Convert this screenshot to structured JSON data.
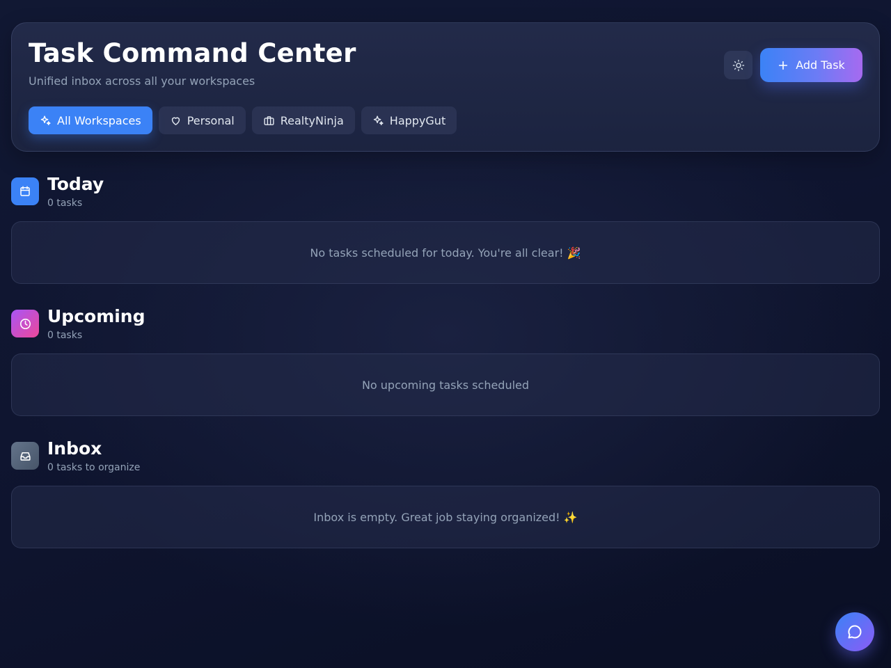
{
  "header": {
    "title": "Task Command Center",
    "subtitle": "Unified inbox across all your workspaces",
    "theme_toggle_icon": "sun-icon",
    "add_task_label": "Add Task",
    "add_task_icon": "plus-icon"
  },
  "workspaces": [
    {
      "label": "All Workspaces",
      "icon": "sparkles-icon",
      "active": true
    },
    {
      "label": "Personal",
      "icon": "heart-icon",
      "active": false
    },
    {
      "label": "RealtyNinja",
      "icon": "briefcase-icon",
      "active": false
    },
    {
      "label": "HappyGut",
      "icon": "sparkles-icon",
      "active": false
    }
  ],
  "sections": {
    "today": {
      "title": "Today",
      "count": "0 tasks",
      "icon": "calendar-icon",
      "empty_message": "No tasks scheduled for today. You're all clear! 🎉"
    },
    "upcoming": {
      "title": "Upcoming",
      "count": "0 tasks",
      "icon": "clock-icon",
      "empty_message": "No upcoming tasks scheduled"
    },
    "inbox": {
      "title": "Inbox",
      "count": "0 tasks to organize",
      "icon": "inbox-icon",
      "empty_message": "Inbox is empty. Great job staying organized! ✨"
    }
  },
  "chat_button_icon": "chat-bubble-icon",
  "colors": {
    "accent_blue": "#3b82f6",
    "accent_purple": "#a855f7",
    "today_icon_bg": "#3b82f6",
    "upcoming_icon_bg": "#c04ad8",
    "inbox_icon_bg": "#4b5563"
  }
}
